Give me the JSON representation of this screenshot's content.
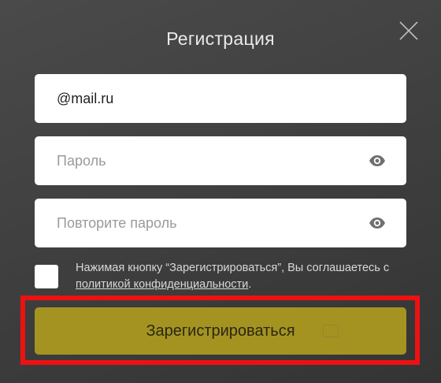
{
  "modal": {
    "title": "Регистрация",
    "close_icon": "close-icon"
  },
  "form": {
    "email": {
      "value": "@mail.ru",
      "placeholder": ""
    },
    "password": {
      "value": "",
      "placeholder": "Пароль",
      "icon": "eye-icon"
    },
    "repeat_password": {
      "value": "",
      "placeholder": "Повторите пароль",
      "icon": "eye-icon"
    },
    "agreement": {
      "checked": false,
      "text_before": "Нажимая кнопку “Зарегистрироваться”, Вы соглашаетесь с ",
      "link": "политикой конфиденциальности",
      "text_after": "."
    },
    "submit_label": "Зарегистрироваться"
  },
  "colors": {
    "background": "#3e3e3e",
    "submit": "#a49321",
    "highlight": "#ee1111"
  }
}
